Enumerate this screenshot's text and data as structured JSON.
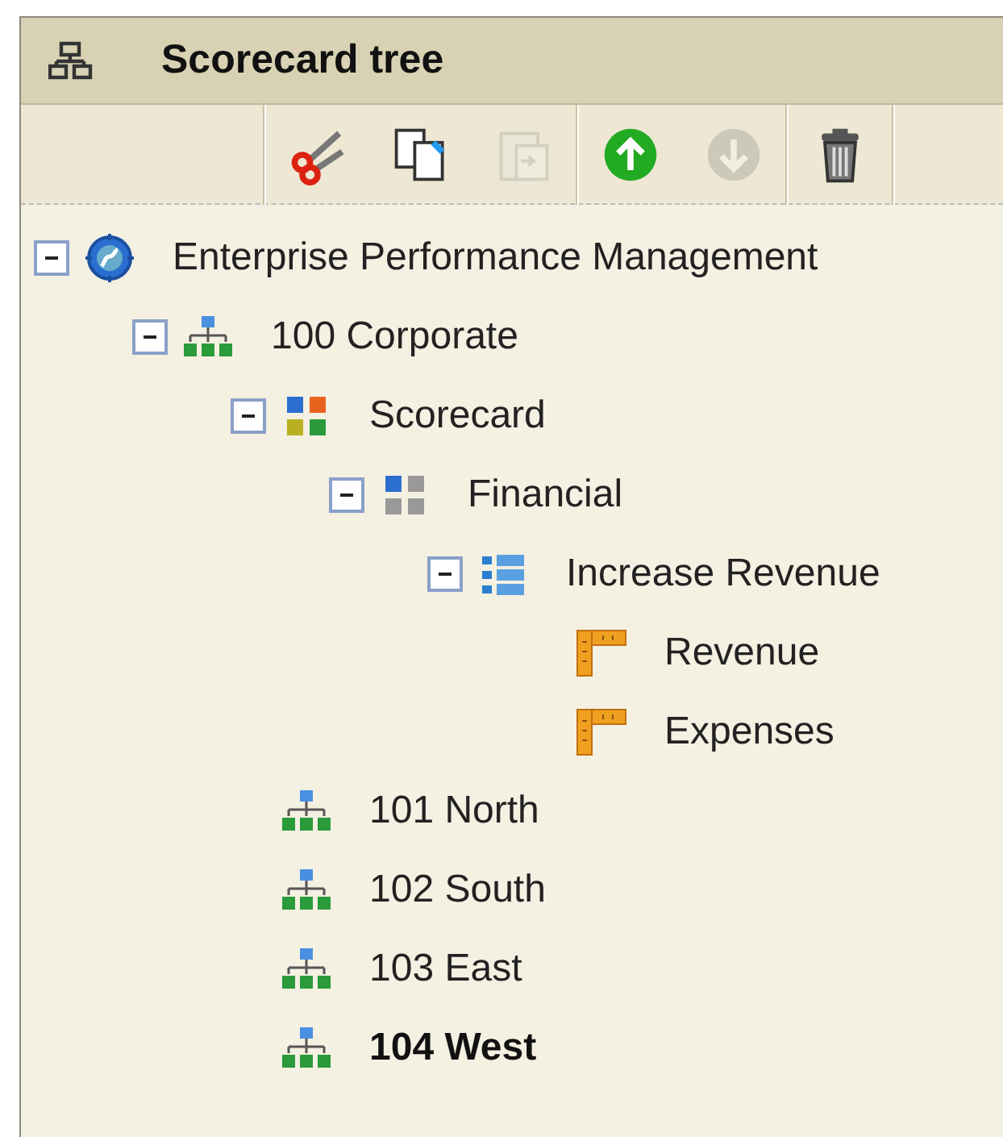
{
  "panel": {
    "title": "Scorecard tree"
  },
  "toolbar": [
    {
      "kind": "cut",
      "disabled": false
    },
    {
      "kind": "copy",
      "disabled": false
    },
    {
      "kind": "paste",
      "disabled": true
    },
    {
      "kind": "up",
      "disabled": false
    },
    {
      "kind": "down",
      "disabled": true
    },
    {
      "kind": "delete",
      "disabled": false
    }
  ],
  "tree": [
    {
      "kind": "enterprise",
      "label": "Enterprise Performance Management",
      "expanded": true,
      "selected": false,
      "children": [
        {
          "kind": "unit",
          "label": "100 Corporate",
          "expanded": true,
          "selected": false,
          "children": [
            {
              "kind": "scorecard",
              "label": "Scorecard",
              "expanded": true,
              "selected": false,
              "children": [
                {
                  "kind": "perspective",
                  "label": "Financial",
                  "expanded": true,
                  "selected": false,
                  "children": [
                    {
                      "kind": "objective",
                      "label": "Increase Revenue",
                      "expanded": true,
                      "selected": false,
                      "children": [
                        {
                          "kind": "kpi",
                          "label": "Revenue",
                          "selected": false
                        },
                        {
                          "kind": "kpi",
                          "label": "Expenses",
                          "selected": false
                        }
                      ]
                    }
                  ]
                }
              ]
            },
            {
              "kind": "unit",
              "label": "101 North",
              "selected": false
            },
            {
              "kind": "unit",
              "label": "102 South",
              "selected": false
            },
            {
              "kind": "unit",
              "label": "103 East",
              "selected": false
            },
            {
              "kind": "unit",
              "label": "104 West",
              "selected": true
            }
          ]
        }
      ]
    }
  ]
}
